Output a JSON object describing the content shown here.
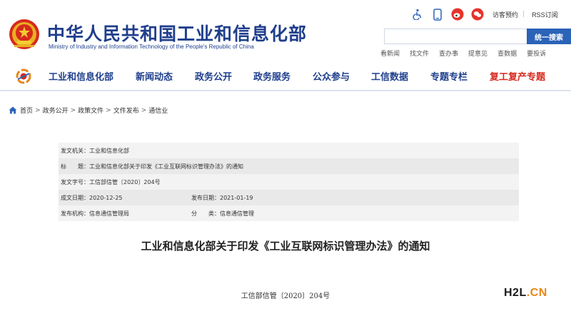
{
  "header": {
    "title": "中华人民共和国工业和信息化部",
    "subtitle": "Ministry of Industry and Information Technology of the People's Republic of China",
    "top_links": [
      "访客预约",
      "RSS订阅"
    ],
    "search_placeholder": "",
    "search_button": "统一搜索",
    "quick_links": [
      "看新闻",
      "找文件",
      "查办事",
      "提意见",
      "查数据",
      "要投诉"
    ]
  },
  "nav": {
    "items": [
      "工业和信息化部",
      "新闻动态",
      "政务公开",
      "政务服务",
      "公众参与",
      "工信数据",
      "专题专栏",
      "复工复产专题"
    ]
  },
  "breadcrumb": [
    "首页",
    "政务公开",
    "政策文件",
    "文件发布",
    "通信业"
  ],
  "info": {
    "issuer_label": "发文机关：",
    "issuer": "工业和信息化部",
    "title_label": "标　　题：",
    "title": "工业和信息化部关于印发《工业互联网标识管理办法》的通知",
    "doc_no_label": "发文字号：",
    "doc_no": "工信部信管〔2020〕204号",
    "date_label": "成文日期：",
    "date": "2020-12-25",
    "pub_label": "发布日期：",
    "pub": "2021-01-19",
    "org_label": "发布机构：",
    "org": "信息通信管理局",
    "cat_label": "分　　类：",
    "cat": "信息通信管理"
  },
  "document": {
    "heading": "工业和信息化部关于印发《工业互联网标识管理办法》的通知",
    "number": "工信部信管〔2020〕204号"
  },
  "watermark": {
    "part_a": "H2L",
    "part_b": ".CN"
  },
  "colors": {
    "brand_blue": "#1f3e8c",
    "button_blue": "#2b63b8",
    "hot_red": "#d6291e"
  },
  "icons": [
    "wheelchair-icon",
    "mobile-icon",
    "weibo-icon",
    "wechat-icon",
    "home-icon",
    "search-icon"
  ]
}
